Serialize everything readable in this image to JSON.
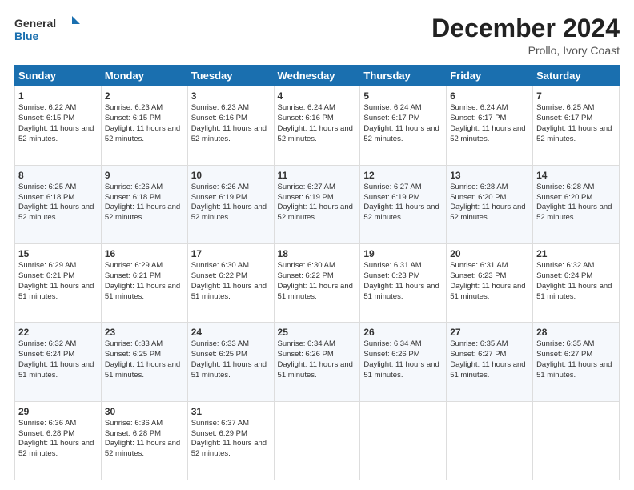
{
  "header": {
    "logo_line1": "General",
    "logo_line2": "Blue",
    "month_title": "December 2024",
    "subtitle": "Prollo, Ivory Coast"
  },
  "days_of_week": [
    "Sunday",
    "Monday",
    "Tuesday",
    "Wednesday",
    "Thursday",
    "Friday",
    "Saturday"
  ],
  "weeks": [
    [
      {
        "day": "1",
        "sunrise": "6:22 AM",
        "sunset": "6:15 PM",
        "daylight": "11 hours and 52 minutes."
      },
      {
        "day": "2",
        "sunrise": "6:23 AM",
        "sunset": "6:15 PM",
        "daylight": "11 hours and 52 minutes."
      },
      {
        "day": "3",
        "sunrise": "6:23 AM",
        "sunset": "6:16 PM",
        "daylight": "11 hours and 52 minutes."
      },
      {
        "day": "4",
        "sunrise": "6:24 AM",
        "sunset": "6:16 PM",
        "daylight": "11 hours and 52 minutes."
      },
      {
        "day": "5",
        "sunrise": "6:24 AM",
        "sunset": "6:17 PM",
        "daylight": "11 hours and 52 minutes."
      },
      {
        "day": "6",
        "sunrise": "6:24 AM",
        "sunset": "6:17 PM",
        "daylight": "11 hours and 52 minutes."
      },
      {
        "day": "7",
        "sunrise": "6:25 AM",
        "sunset": "6:17 PM",
        "daylight": "11 hours and 52 minutes."
      }
    ],
    [
      {
        "day": "8",
        "sunrise": "6:25 AM",
        "sunset": "6:18 PM",
        "daylight": "11 hours and 52 minutes."
      },
      {
        "day": "9",
        "sunrise": "6:26 AM",
        "sunset": "6:18 PM",
        "daylight": "11 hours and 52 minutes."
      },
      {
        "day": "10",
        "sunrise": "6:26 AM",
        "sunset": "6:19 PM",
        "daylight": "11 hours and 52 minutes."
      },
      {
        "day": "11",
        "sunrise": "6:27 AM",
        "sunset": "6:19 PM",
        "daylight": "11 hours and 52 minutes."
      },
      {
        "day": "12",
        "sunrise": "6:27 AM",
        "sunset": "6:19 PM",
        "daylight": "11 hours and 52 minutes."
      },
      {
        "day": "13",
        "sunrise": "6:28 AM",
        "sunset": "6:20 PM",
        "daylight": "11 hours and 52 minutes."
      },
      {
        "day": "14",
        "sunrise": "6:28 AM",
        "sunset": "6:20 PM",
        "daylight": "11 hours and 52 minutes."
      }
    ],
    [
      {
        "day": "15",
        "sunrise": "6:29 AM",
        "sunset": "6:21 PM",
        "daylight": "11 hours and 51 minutes."
      },
      {
        "day": "16",
        "sunrise": "6:29 AM",
        "sunset": "6:21 PM",
        "daylight": "11 hours and 51 minutes."
      },
      {
        "day": "17",
        "sunrise": "6:30 AM",
        "sunset": "6:22 PM",
        "daylight": "11 hours and 51 minutes."
      },
      {
        "day": "18",
        "sunrise": "6:30 AM",
        "sunset": "6:22 PM",
        "daylight": "11 hours and 51 minutes."
      },
      {
        "day": "19",
        "sunrise": "6:31 AM",
        "sunset": "6:23 PM",
        "daylight": "11 hours and 51 minutes."
      },
      {
        "day": "20",
        "sunrise": "6:31 AM",
        "sunset": "6:23 PM",
        "daylight": "11 hours and 51 minutes."
      },
      {
        "day": "21",
        "sunrise": "6:32 AM",
        "sunset": "6:24 PM",
        "daylight": "11 hours and 51 minutes."
      }
    ],
    [
      {
        "day": "22",
        "sunrise": "6:32 AM",
        "sunset": "6:24 PM",
        "daylight": "11 hours and 51 minutes."
      },
      {
        "day": "23",
        "sunrise": "6:33 AM",
        "sunset": "6:25 PM",
        "daylight": "11 hours and 51 minutes."
      },
      {
        "day": "24",
        "sunrise": "6:33 AM",
        "sunset": "6:25 PM",
        "daylight": "11 hours and 51 minutes."
      },
      {
        "day": "25",
        "sunrise": "6:34 AM",
        "sunset": "6:26 PM",
        "daylight": "11 hours and 51 minutes."
      },
      {
        "day": "26",
        "sunrise": "6:34 AM",
        "sunset": "6:26 PM",
        "daylight": "11 hours and 51 minutes."
      },
      {
        "day": "27",
        "sunrise": "6:35 AM",
        "sunset": "6:27 PM",
        "daylight": "11 hours and 51 minutes."
      },
      {
        "day": "28",
        "sunrise": "6:35 AM",
        "sunset": "6:27 PM",
        "daylight": "11 hours and 51 minutes."
      }
    ],
    [
      {
        "day": "29",
        "sunrise": "6:36 AM",
        "sunset": "6:28 PM",
        "daylight": "11 hours and 52 minutes."
      },
      {
        "day": "30",
        "sunrise": "6:36 AM",
        "sunset": "6:28 PM",
        "daylight": "11 hours and 52 minutes."
      },
      {
        "day": "31",
        "sunrise": "6:37 AM",
        "sunset": "6:29 PM",
        "daylight": "11 hours and 52 minutes."
      },
      null,
      null,
      null,
      null
    ]
  ]
}
